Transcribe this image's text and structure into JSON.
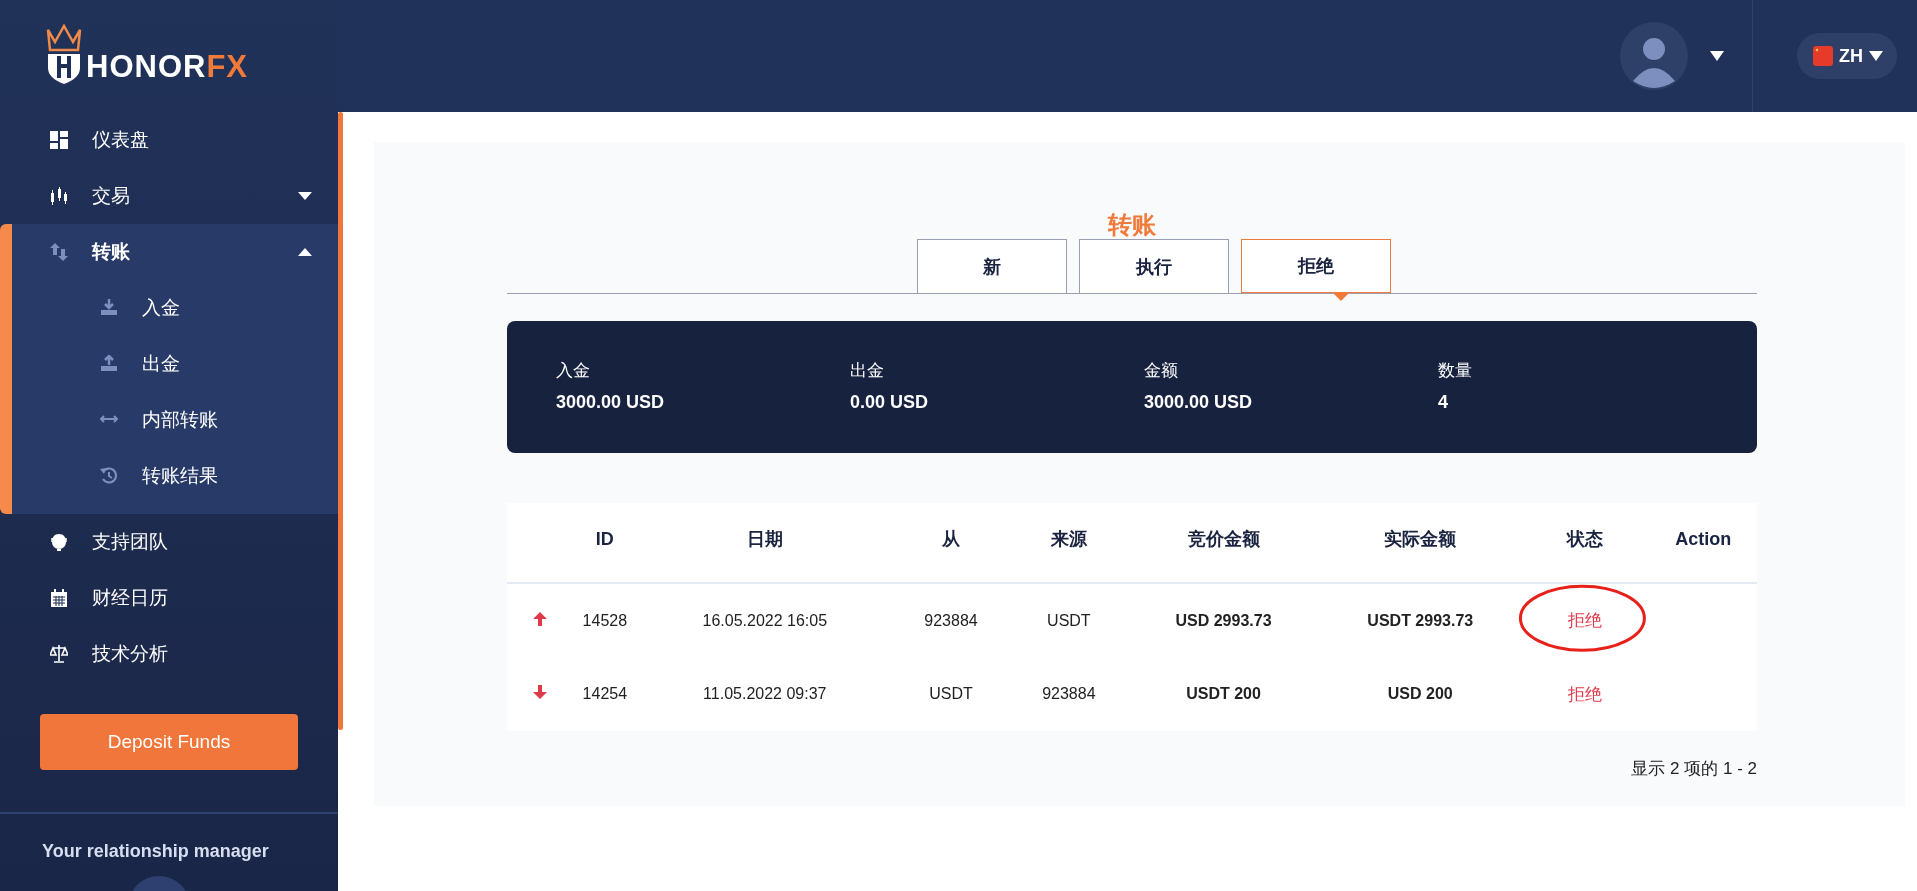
{
  "logo": {
    "text": "HONOR",
    "accent": "FX"
  },
  "header": {
    "language": "ZH"
  },
  "sidebar": {
    "items": [
      {
        "label": "仪表盘",
        "selected": false
      },
      {
        "label": "交易",
        "selected": false,
        "expanded": false
      },
      {
        "label": "转账",
        "selected": true,
        "expanded": true,
        "children": [
          {
            "label": "入金"
          },
          {
            "label": "出金"
          },
          {
            "label": "内部转账"
          },
          {
            "label": "转账结果"
          }
        ]
      },
      {
        "label": "支持团队",
        "selected": false
      },
      {
        "label": "财经日历",
        "selected": false
      },
      {
        "label": "技术分析",
        "selected": false
      }
    ],
    "deposit_button": "Deposit Funds",
    "manager_title": "Your relationship manager"
  },
  "page_title": "转账",
  "tabs": [
    {
      "label": "新",
      "selected": false
    },
    {
      "label": "执行",
      "selected": false
    },
    {
      "label": "拒绝",
      "selected": true
    }
  ],
  "summary": [
    {
      "label": "入金",
      "value": "3000.00 USD"
    },
    {
      "label": "出金",
      "value": "0.00 USD"
    },
    {
      "label": "金额",
      "value": "3000.00 USD"
    },
    {
      "label": "数量",
      "value": "4"
    }
  ],
  "table": {
    "columns": [
      "ID",
      "日期",
      "从",
      "来源",
      "竞价金额",
      "实际金额",
      "状态",
      "Action"
    ],
    "rows": [
      {
        "kind": "up",
        "id": "14528",
        "date": "16.05.2022 16:05",
        "from": "923884",
        "source": "USDT",
        "bid_amount": "USD 2993.73",
        "actual_amount": "USDT 2993.73",
        "status": "拒绝",
        "circled": true
      },
      {
        "kind": "down",
        "id": "14254",
        "date": "11.05.2022 09:37",
        "from": "USDT",
        "source": "923884",
        "bid_amount": "USDT 200",
        "actual_amount": "USD 200",
        "status": "拒绝",
        "circled": false
      }
    ]
  },
  "pagination": "显示 2 项的 1 - 2"
}
